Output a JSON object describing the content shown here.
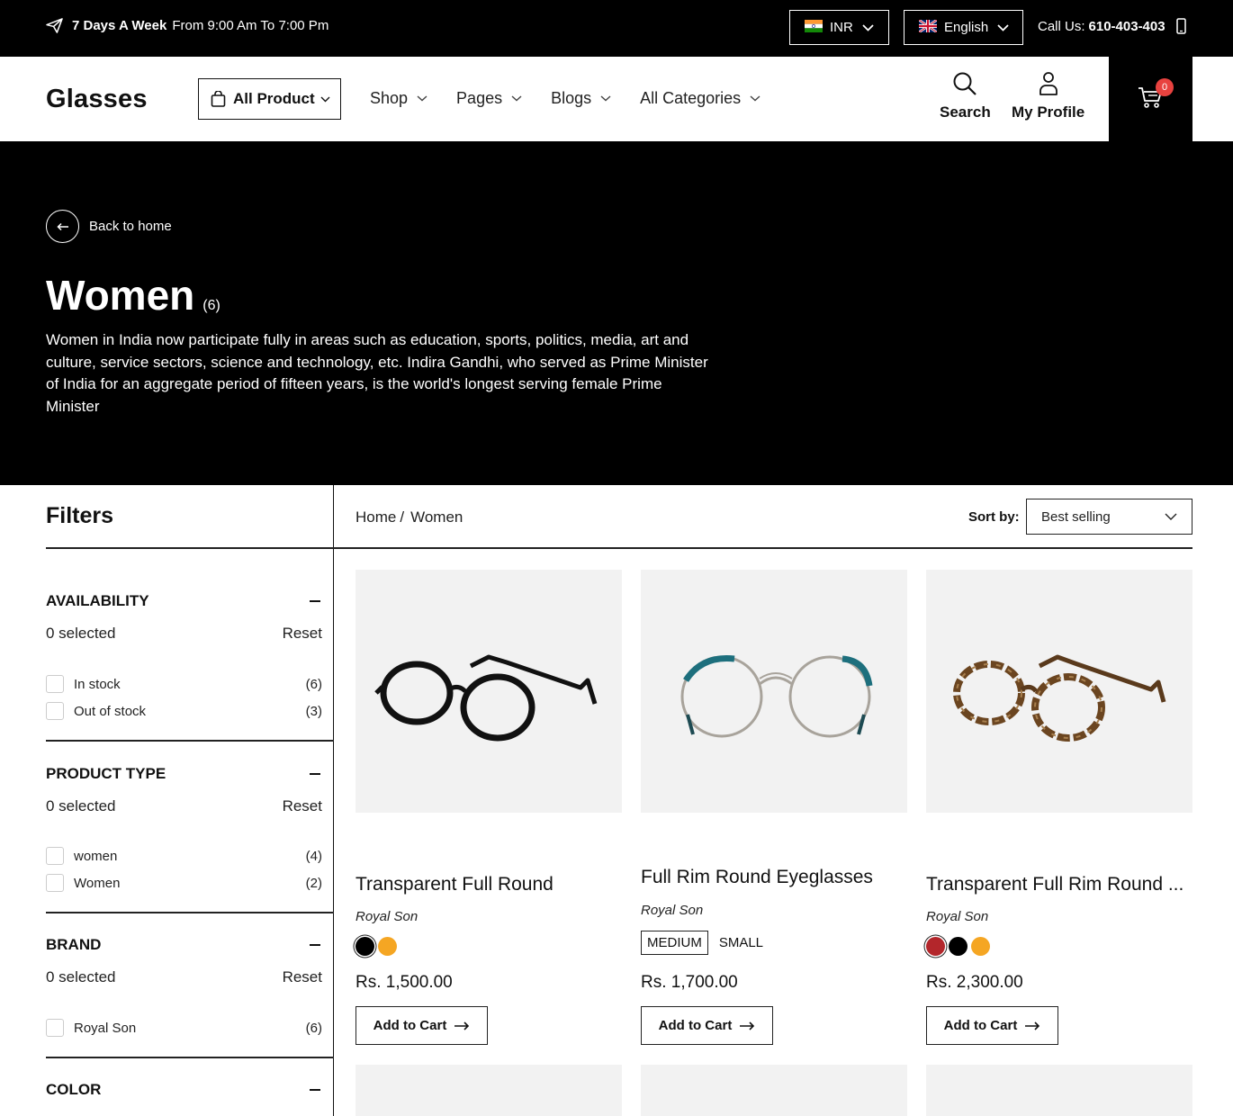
{
  "topbar": {
    "hours_bold": "7 Days A Week",
    "hours_text": "From 9:00 Am To 7:00 Pm",
    "currency": "INR",
    "language": "English",
    "call_label": "Call Us:",
    "call_number": "610-403-403"
  },
  "header": {
    "logo": "Glasses",
    "all_product": "All Product",
    "nav": [
      "Shop",
      "Pages",
      "Blogs",
      "All Categories"
    ],
    "search_label": "Search",
    "profile_label": "My Profile",
    "cart_count": "0"
  },
  "hero": {
    "back_label": "Back to home",
    "title": "Women",
    "count": "(6)",
    "description": "Women in India now participate fully in areas such as education, sports, politics, media, art and culture, service sectors, science and technology, etc. Indira Gandhi, who served as Prime Minister of India for an aggregate period of fifteen years, is the world's longest serving female Prime Minister"
  },
  "filters": {
    "title": "Filters",
    "sections": [
      {
        "name": "AVAILABILITY",
        "selected": "0 selected",
        "reset": "Reset",
        "options": [
          {
            "label": "In stock",
            "count": "(6)"
          },
          {
            "label": "Out of stock",
            "count": "(3)"
          }
        ]
      },
      {
        "name": "PRODUCT TYPE",
        "selected": "0 selected",
        "reset": "Reset",
        "options": [
          {
            "label": "women",
            "count": "(4)"
          },
          {
            "label": "Women",
            "count": "(2)"
          }
        ]
      },
      {
        "name": "BRAND",
        "selected": "0 selected",
        "reset": "Reset",
        "options": [
          {
            "label": "Royal Son",
            "count": "(6)"
          }
        ]
      },
      {
        "name": "COLOR"
      }
    ]
  },
  "breadcrumb": {
    "home": "Home",
    "separator": "/",
    "current": "Women"
  },
  "sort": {
    "label": "Sort by:",
    "value": "Best selling"
  },
  "products": [
    {
      "title": "Transparent Full Round",
      "brand": "Royal Son",
      "colors": [
        "#000000",
        "#f5a623"
      ],
      "price": "Rs. 1,500.00",
      "cta": "Add to Cart"
    },
    {
      "title": "Full Rim Round Eyeglasses",
      "brand": "Royal Son",
      "sizes": [
        "MEDIUM",
        "SMALL"
      ],
      "price": "Rs. 1,700.00",
      "cta": "Add to Cart"
    },
    {
      "title": "Transparent Full Rim Round ...",
      "brand": "Royal Son",
      "colors": [
        "#b3262b",
        "#000000",
        "#f5a623"
      ],
      "price": "Rs. 2,300.00",
      "cta": "Add to Cart"
    }
  ]
}
